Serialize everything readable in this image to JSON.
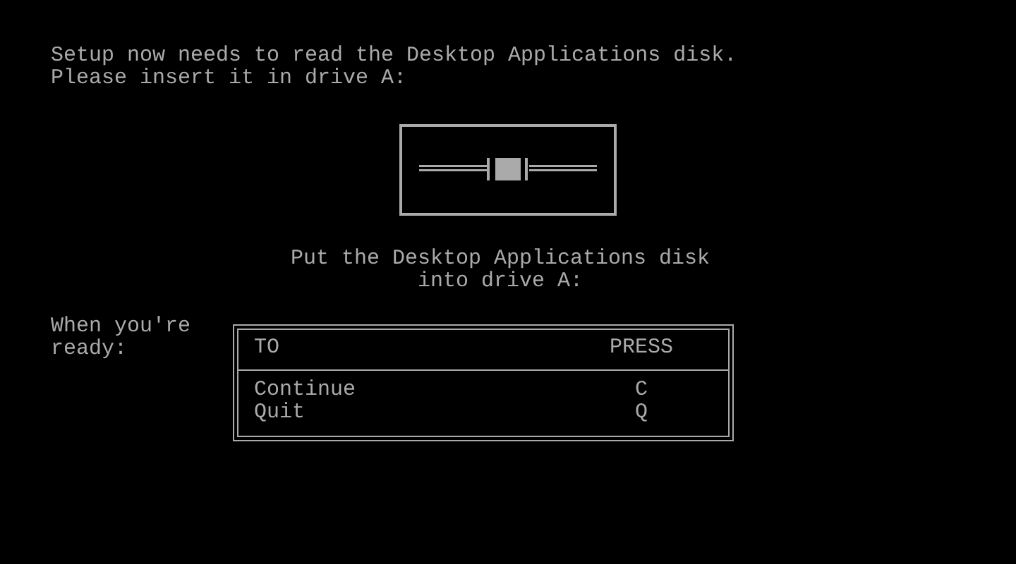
{
  "message": [
    "Setup now needs to read the Desktop Applications disk.",
    "Please insert it in drive A:"
  ],
  "instruction": [
    "Put the Desktop Applications disk",
    "into drive A:"
  ],
  "prompt": [
    "When you're",
    "ready:"
  ],
  "table": {
    "columns": [
      "TO",
      "PRESS"
    ],
    "rows": [
      {
        "action": "Continue",
        "key": "C"
      },
      {
        "action": "Quit",
        "key": "Q"
      }
    ]
  }
}
